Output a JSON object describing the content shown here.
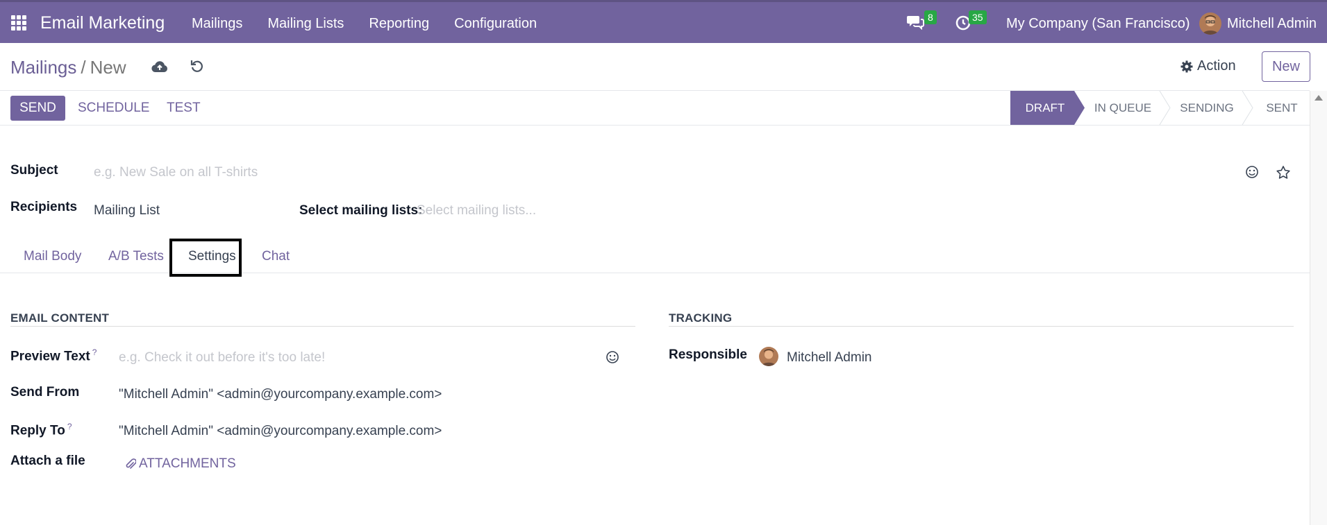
{
  "navbar": {
    "brand": "Email Marketing",
    "menu": [
      "Mailings",
      "Mailing Lists",
      "Reporting",
      "Configuration"
    ],
    "messages_count": "8",
    "activities_count": "35",
    "company": "My Company (San Francisco)",
    "user": "Mitchell Admin",
    "bg_color": "#71639e",
    "badge_color": "#28a745"
  },
  "control_panel": {
    "breadcrumb_parent": "Mailings",
    "breadcrumb_sep": "/",
    "breadcrumb_current": "New",
    "action_label": "Action",
    "new_label": "New"
  },
  "statusbar": {
    "send_label": "SEND",
    "schedule_label": "SCHEDULE",
    "test_label": "TEST",
    "stages": [
      "DRAFT",
      "IN QUEUE",
      "SENDING",
      "SENT"
    ],
    "active_stage": "DRAFT"
  },
  "form": {
    "subject_label": "Subject",
    "subject_placeholder": "e.g. New Sale on all T-shirts",
    "recipients_label": "Recipients",
    "recipients_value": "Mailing List",
    "mailing_lists_label": "Select mailing lists:",
    "mailing_lists_placeholder": "Select mailing lists..."
  },
  "tabs": {
    "items": [
      "Mail Body",
      "A/B Tests",
      "Settings",
      "Chat"
    ],
    "active": "Settings"
  },
  "settings": {
    "email_content_title": "EMAIL CONTENT",
    "preview_label": "Preview Text",
    "preview_help": "?",
    "preview_placeholder": "e.g. Check it out before it's too late!",
    "send_from_label": "Send From",
    "send_from_value": "\"Mitchell Admin\" <admin@yourcompany.example.com>",
    "reply_to_label": "Reply To",
    "reply_to_help": "?",
    "reply_to_value": "\"Mitchell Admin\" <admin@yourcompany.example.com>",
    "attach_label": "Attach a file",
    "attachments_label": "ATTACHMENTS",
    "tracking_title": "TRACKING",
    "responsible_label": "Responsible",
    "responsible_value": "Mitchell Admin"
  }
}
